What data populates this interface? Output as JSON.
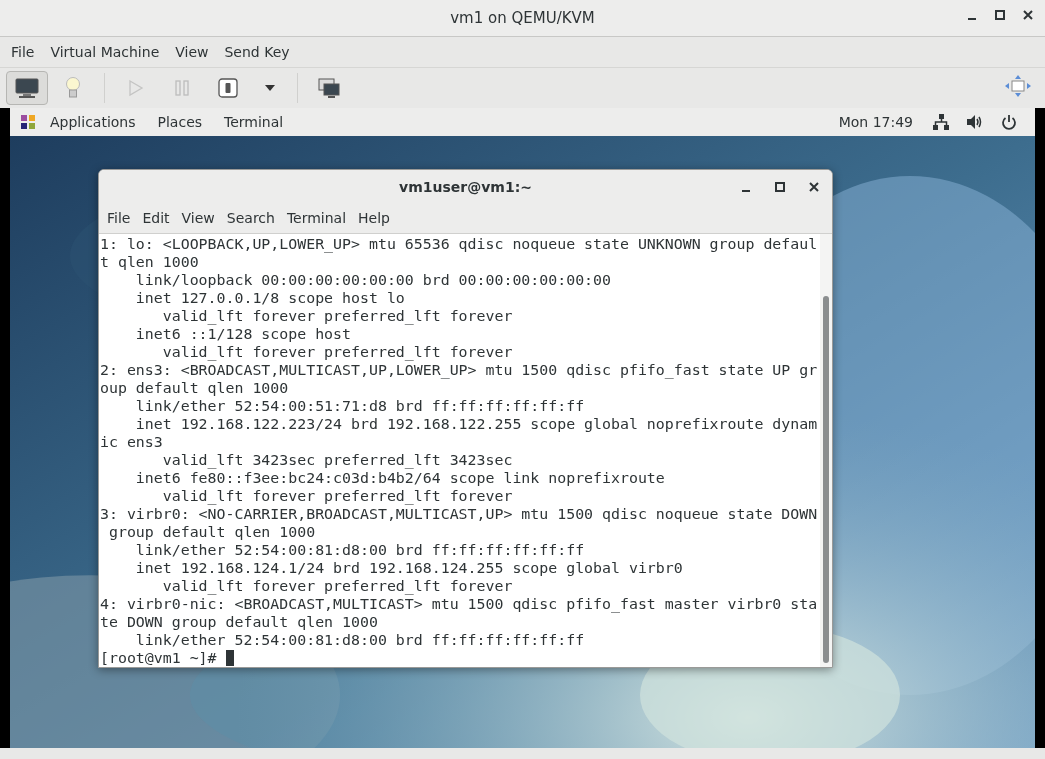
{
  "window": {
    "title": "vm1 on QEMU/KVM"
  },
  "menu": [
    "File",
    "Virtual Machine",
    "View",
    "Send Key"
  ],
  "toolbar": [
    {
      "kind": "console",
      "selected": true,
      "disabled": false
    },
    {
      "kind": "details",
      "selected": false,
      "disabled": false
    },
    {
      "kind": "run",
      "selected": false,
      "disabled": true
    },
    {
      "kind": "pause",
      "selected": false,
      "disabled": true
    },
    {
      "kind": "shutdown",
      "selected": false,
      "disabled": false
    },
    {
      "kind": "caret",
      "selected": false,
      "disabled": false
    },
    {
      "kind": "snapshots",
      "selected": false,
      "disabled": false
    }
  ],
  "guest": {
    "top_bar": {
      "menus": [
        "Applications",
        "Places",
        "Terminal"
      ],
      "clock": "Mon 17:49"
    },
    "terminal": {
      "title": "vm1user@vm1:~",
      "menu": [
        "File",
        "Edit",
        "View",
        "Search",
        "Terminal",
        "Help"
      ],
      "lines": [
        "1: lo: <LOOPBACK,UP,LOWER_UP> mtu 65536 qdisc noqueue state UNKNOWN group defaul",
        "t qlen 1000",
        "    link/loopback 00:00:00:00:00:00 brd 00:00:00:00:00:00",
        "    inet 127.0.0.1/8 scope host lo",
        "       valid_lft forever preferred_lft forever",
        "    inet6 ::1/128 scope host",
        "       valid_lft forever preferred_lft forever",
        "2: ens3: <BROADCAST,MULTICAST,UP,LOWER_UP> mtu 1500 qdisc pfifo_fast state UP gr",
        "oup default qlen 1000",
        "    link/ether 52:54:00:51:71:d8 brd ff:ff:ff:ff:ff:ff",
        "    inet 192.168.122.223/24 brd 192.168.122.255 scope global noprefixroute dynam",
        "ic ens3",
        "       valid_lft 3423sec preferred_lft 3423sec",
        "    inet6 fe80::f3ee:bc24:c03d:b4b2/64 scope link noprefixroute",
        "       valid_lft forever preferred_lft forever",
        "3: virbr0: <NO-CARRIER,BROADCAST,MULTICAST,UP> mtu 1500 qdisc noqueue state DOWN",
        " group default qlen 1000",
        "    link/ether 52:54:00:81:d8:00 brd ff:ff:ff:ff:ff:ff",
        "    inet 192.168.124.1/24 brd 192.168.124.255 scope global virbr0",
        "       valid_lft forever preferred_lft forever",
        "4: virbr0-nic: <BROADCAST,MULTICAST> mtu 1500 qdisc pfifo_fast master virbr0 sta",
        "te DOWN group default qlen 1000",
        "    link/ether 52:54:00:81:d8:00 brd ff:ff:ff:ff:ff:ff"
      ],
      "prompt": "[root@vm1 ~]#"
    }
  }
}
